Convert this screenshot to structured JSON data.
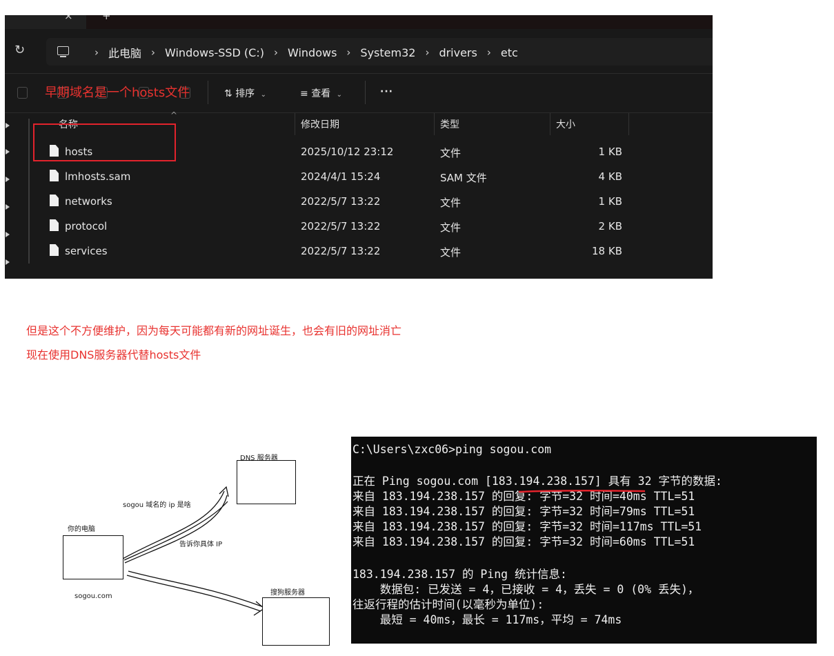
{
  "explorer": {
    "tab_close_glyph": "×",
    "tab_new_glyph": "+",
    "refresh_glyph": "↻",
    "breadcrumbs": [
      "此电脑",
      "Windows-SSD (C:)",
      "Windows",
      "System32",
      "drivers",
      "etc"
    ],
    "toolbar": {
      "sort_label": "排序",
      "sort_glyph": "⇅",
      "view_label": "查看",
      "view_glyph": "≡",
      "more_glyph": "···",
      "dropdown_glyph": "⌄"
    },
    "columns": [
      "名称",
      "修改日期",
      "类型",
      "大小"
    ],
    "sort_caret": "^",
    "files": [
      {
        "name": "hosts",
        "modified": "2025/10/12 23:12",
        "type": "文件",
        "size": "1 KB"
      },
      {
        "name": "lmhosts.sam",
        "modified": "2024/4/1 15:24",
        "type": "SAM 文件",
        "size": "4 KB"
      },
      {
        "name": "networks",
        "modified": "2022/5/7 13:22",
        "type": "文件",
        "size": "1 KB"
      },
      {
        "name": "protocol",
        "modified": "2022/5/7 13:22",
        "type": "文件",
        "size": "2 KB"
      },
      {
        "name": "services",
        "modified": "2022/5/7 13:22",
        "type": "文件",
        "size": "18 KB"
      }
    ]
  },
  "annotations": {
    "top": "早期域名是一个hosts文件",
    "line1": "但是这个不方便维护，因为每天可能都有新的网址诞生，也会有旧的网址消亡",
    "line2": "现在使用DNS服务器代替hosts文件",
    "accent_color": "#e8322f"
  },
  "diagram": {
    "dns_label": "DNS 服务器",
    "pc_label": "你的电脑",
    "sogou_server_label": "搜狗服务器",
    "domain_label": "sogou.com",
    "question_label": "sogou 域名的 ip 是啥",
    "answer_label": "告诉你具体 IP"
  },
  "terminal": {
    "lines": [
      "C:\\Users\\zxc06>ping sogou.com",
      "",
      "正在 Ping sogou.com [183.194.238.157] 具有 32 字节的数据:",
      "来自 183.194.238.157 的回复: 字节=32 时间=40ms TTL=51",
      "来自 183.194.238.157 的回复: 字节=32 时间=79ms TTL=51",
      "来自 183.194.238.157 的回复: 字节=32 时间=117ms TTL=51",
      "来自 183.194.238.157 的回复: 字节=32 时间=60ms TTL=51",
      "",
      "183.194.238.157 的 Ping 统计信息:",
      "    数据包: 已发送 = 4，已接收 = 4，丢失 = 0 (0% 丢失)，",
      "往返行程的估计时间(以毫秒为单位):",
      "    最短 = 40ms，最长 = 117ms，平均 = 74ms"
    ]
  }
}
